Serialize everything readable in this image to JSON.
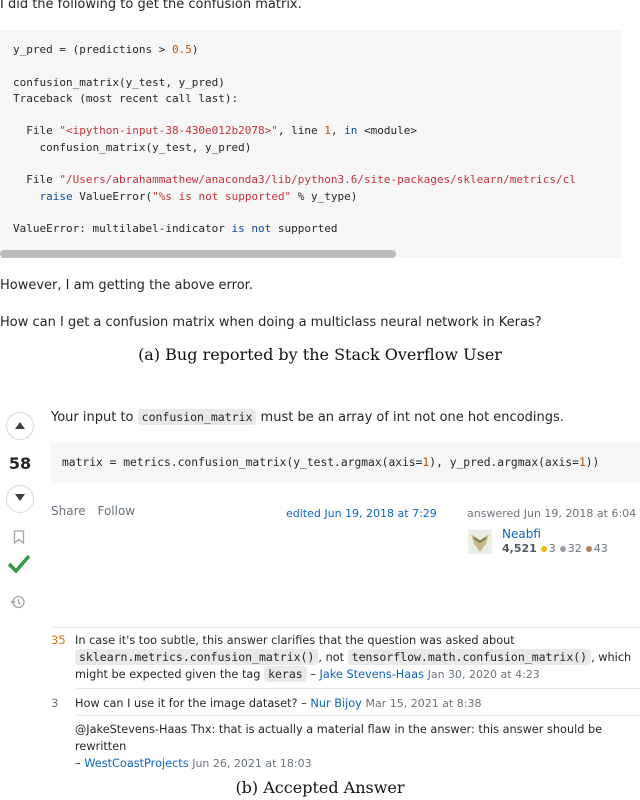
{
  "question": {
    "intro": "I did the following to get the confusion matrix.",
    "code": {
      "l1a": "y_pred = (predictions > ",
      "l1num": "0.5",
      "l1b": ")",
      "l2": "confusion_matrix(y_test, y_pred)",
      "l3": "Traceback (most recent call last):",
      "l4a": "  File ",
      "l4str": "\"<ipython-input-38-430e012b2078>\"",
      "l4b": ", line ",
      "l4num": "1",
      "l4c": ", ",
      "l4kw": "in",
      "l4d": " <module>",
      "l5": "    confusion_matrix(y_test, y_pred)",
      "l6a": "  File ",
      "l6str": "\"/Users/abrahammathew/anaconda3/lib/python3.6/site-packages/sklearn/metrics/cl",
      "l7a": "    ",
      "l7kw": "raise",
      "l7b": " ValueError(",
      "l7str": "\"%s is not supported\"",
      "l7c": " % y_type)",
      "l8a": "ValueError: multilabel-indicator ",
      "l8kw1": "is",
      "l8b": " ",
      "l8kw2": "not",
      "l8c": " supported"
    },
    "para1": "However, I am getting the above error.",
    "para2": "How can I get a confusion matrix when doing a multiclass neural network in Keras?",
    "caption": "(a) Bug reported by the Stack Overflow User"
  },
  "answer": {
    "score": "58",
    "text_a": "Your input to ",
    "text_code": "confusion_matrix",
    "text_b": " must be an array of int not one hot encodings.",
    "code": {
      "a": "matrix = metrics.confusion_matrix(y_test.argmax(axis=",
      "n1": "1",
      "b": "), y_pred.argmax(axis=",
      "n2": "1",
      "c": "))"
    },
    "share": "Share",
    "follow": "Follow",
    "edited": "edited Jun 19, 2018 at 7:29",
    "answered": "answered Jun 19, 2018 at 6:04",
    "user": {
      "name": "Neabfi",
      "rep": "4,521",
      "gold": "3",
      "silver": "32",
      "bronze": "43"
    },
    "caption": "(b) Accepted Answer"
  },
  "comments": [
    {
      "score": "35",
      "t1": "In case it's too subtle, this answer clarifies that the question was asked about",
      "c1": "sklearn.metrics.confusion_matrix()",
      "t2": ", not ",
      "c2": "tensorflow.math.confusion_matrix()",
      "t3": ", which",
      "t4": "might be expected given the tag ",
      "tag": "keras",
      "dash": " – ",
      "user": "Jake Stevens-Haas",
      "date": "Jan 30, 2020 at 4:23"
    },
    {
      "score": "3",
      "t1": "How can I use it for the image dataset?",
      "dash": " – ",
      "user": "Nur Bijoy",
      "date": "Mar 15, 2021 at 8:38"
    },
    {
      "score": "",
      "t1": "@JakeStevens-Haas Thx: that is actually a material flaw in the answer: this answer should be rewritten",
      "dash": "– ",
      "user": "WestCoastProjects",
      "date": "Jun 26, 2021 at 18:03"
    }
  ],
  "colors": {
    "accent": "#0a64c2",
    "accepted": "#2f9c3f",
    "score_hot": "#c9751a",
    "gold": "#f1b600",
    "silver": "#9a9ea3",
    "bronze": "#ab8251"
  }
}
